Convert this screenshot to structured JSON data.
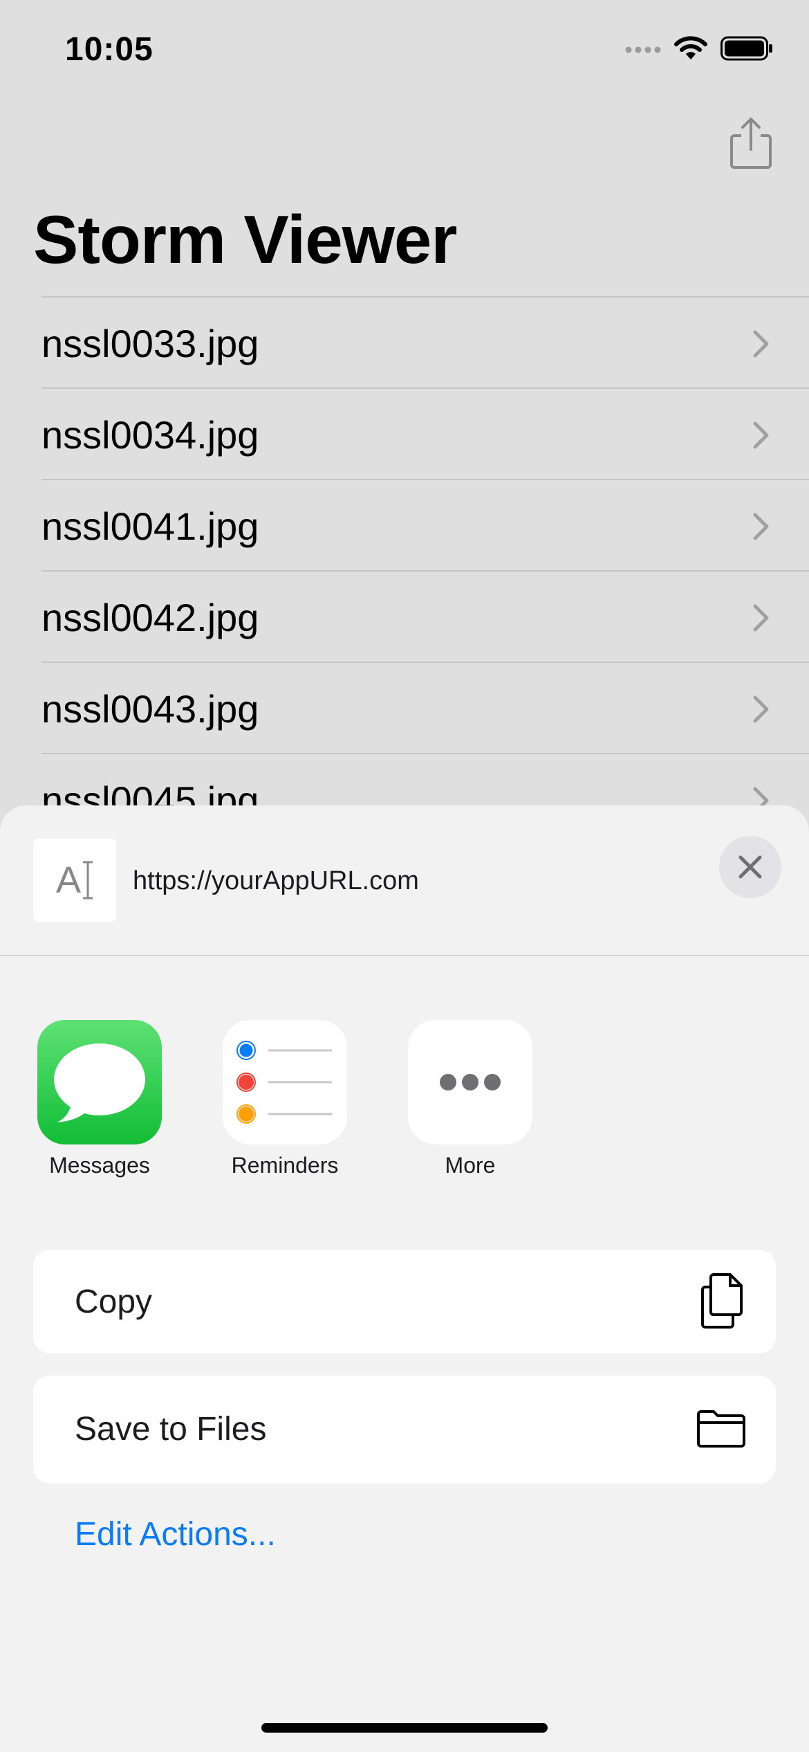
{
  "status_bar": {
    "time": "10:05"
  },
  "nav": {
    "title": "Storm Viewer",
    "share_icon": "share-icon"
  },
  "list": {
    "items": [
      {
        "label": "nssl0033.jpg"
      },
      {
        "label": "nssl0034.jpg"
      },
      {
        "label": "nssl0041.jpg"
      },
      {
        "label": "nssl0042.jpg"
      },
      {
        "label": "nssl0043.jpg"
      },
      {
        "label": "nssl0045.jpg"
      }
    ]
  },
  "share_sheet": {
    "preview_glyph": "A",
    "url": "https://yourAppURL.com",
    "apps": [
      {
        "label": "Messages",
        "icon": "messages-icon",
        "color": "#2fc94a"
      },
      {
        "label": "Reminders",
        "icon": "reminders-icon",
        "color": "#ffffff"
      },
      {
        "label": "More",
        "icon": "more-icon",
        "color": "#ffffff"
      }
    ],
    "actions": [
      {
        "label": "Copy",
        "icon": "copy-icon"
      },
      {
        "label": "Save to Files",
        "icon": "folder-icon"
      }
    ],
    "edit_actions": "Edit Actions...",
    "accent_color": "#0a7cf5"
  }
}
